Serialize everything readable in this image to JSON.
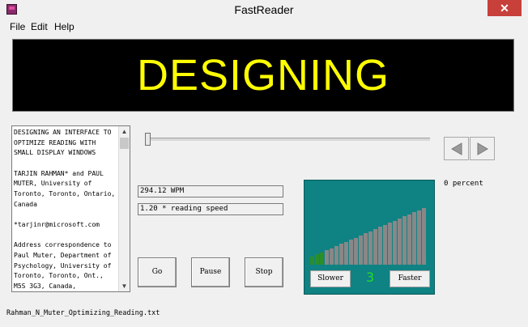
{
  "window": {
    "title": "FastReader",
    "close_glyph": "✕"
  },
  "menu": [
    "File",
    "Edit",
    "Help"
  ],
  "display": {
    "current_word": "DESIGNING",
    "word_color": "#ffff00"
  },
  "text_panel": {
    "paragraphs": [
      "DESIGNING AN INTERFACE TO\nOPTIMIZE READING WITH\nSMALL DISPLAY WINDOWS",
      "TARJIN RAHMAN* and PAUL\nMUTER, University of\nToronto, Toronto, Ontario,\nCanada",
      "*tarjinr@microsoft.com",
      "Address correspondence to\nPaul Muter, Department of\nPsychology, University of\nToronto, Toronto, Ont.,\nM5S 3G3, Canada,"
    ]
  },
  "progress": {
    "position_percent": 0,
    "label": "0 percent"
  },
  "fields": {
    "wpm": "294.12 WPM",
    "speed": "1.20 * reading speed"
  },
  "buttons": {
    "go": "Go",
    "pause": "Pause",
    "stop": "Stop"
  },
  "speed_panel": {
    "slower": "Slower",
    "faster": "Faster",
    "level": "3",
    "level_color": "#22dd22",
    "bar_active_color": "#2a8f2a",
    "bar_inactive_color": "#888888",
    "panel_color": "#0f8283",
    "bar_count": 24,
    "active_bars": 3
  },
  "status": {
    "filename": "Rahman_N_Muter_Optimizing_Reading.txt"
  },
  "icons": {
    "app": "app-icon",
    "close": "close-icon",
    "back": "left-triangle-icon",
    "forward": "right-triangle-icon"
  }
}
